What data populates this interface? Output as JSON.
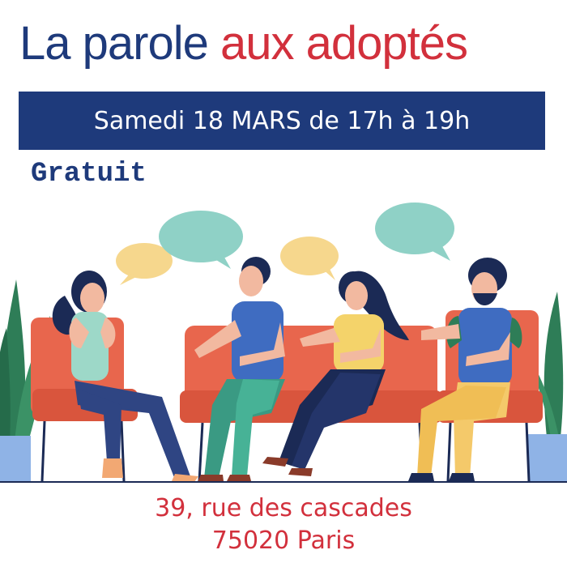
{
  "title": {
    "part1": "La parole",
    "part2": "aux adoptés"
  },
  "banner": {
    "text": "Samedi 18 MARS de 17h à 19h"
  },
  "price": {
    "text": "Gratuit"
  },
  "address": {
    "street": "39, rue des cascades",
    "city": "75020 Paris"
  },
  "colors": {
    "navy": "#1e3a7b",
    "red": "#d2303c",
    "sofa": "#e8664d",
    "bubble_green": "#8fd1c6",
    "bubble_yellow": "#f6d78d",
    "plant": "#2e7d57"
  },
  "illustration": {
    "icon": "group-conversation-illustration"
  }
}
